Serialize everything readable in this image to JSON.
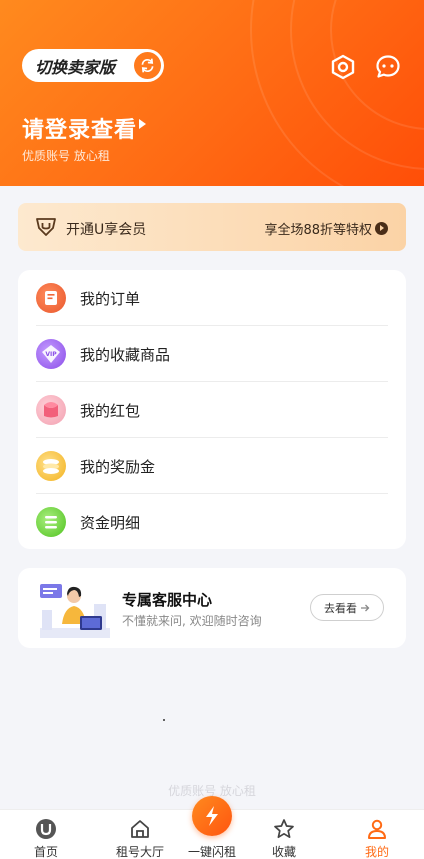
{
  "header": {
    "switch_label": "切换卖家版",
    "login_title": "请登录查看",
    "login_sub": "优质账号 放心租",
    "icons": [
      "settings-icon",
      "message-icon",
      "switch-icon"
    ]
  },
  "vip": {
    "label": "开通U享会员",
    "right_text": "享全场88折等特权",
    "icon": "vip-shield-icon"
  },
  "menu": {
    "items": [
      {
        "label": "我的订单",
        "icon": "order-icon",
        "color": "#f0673a"
      },
      {
        "label": "我的收藏商品",
        "icon": "vip-favorite-icon",
        "color": "#9b5cf0"
      },
      {
        "label": "我的红包",
        "icon": "red-packet-icon",
        "color": "#f2607b"
      },
      {
        "label": "我的奖励金",
        "icon": "reward-coin-icon",
        "color": "#f3b21e"
      },
      {
        "label": "资金明细",
        "icon": "funds-detail-icon",
        "color": "#5ccf2e"
      }
    ]
  },
  "service": {
    "title": "专属客服中心",
    "subtitle": "不懂就来问, 欢迎随时咨询",
    "button": "去看看"
  },
  "watermark": "优质账号 放心租",
  "tabbar": {
    "tabs": [
      {
        "label": "首页",
        "icon": "home-u-icon"
      },
      {
        "label": "租号大厅",
        "icon": "hall-house-icon"
      },
      {
        "label": "一键闪租",
        "icon": "lightning-icon"
      },
      {
        "label": "收藏",
        "icon": "star-icon"
      },
      {
        "label": "我的",
        "icon": "user-icon",
        "active": true
      }
    ]
  },
  "colors": {
    "accent": "#ff6a14",
    "header_gradient_start": "#ff8a1e",
    "header_gradient_end": "#ff4e08",
    "vip_gradient_start": "#fde9cf",
    "vip_gradient_end": "#fbd3a6"
  }
}
